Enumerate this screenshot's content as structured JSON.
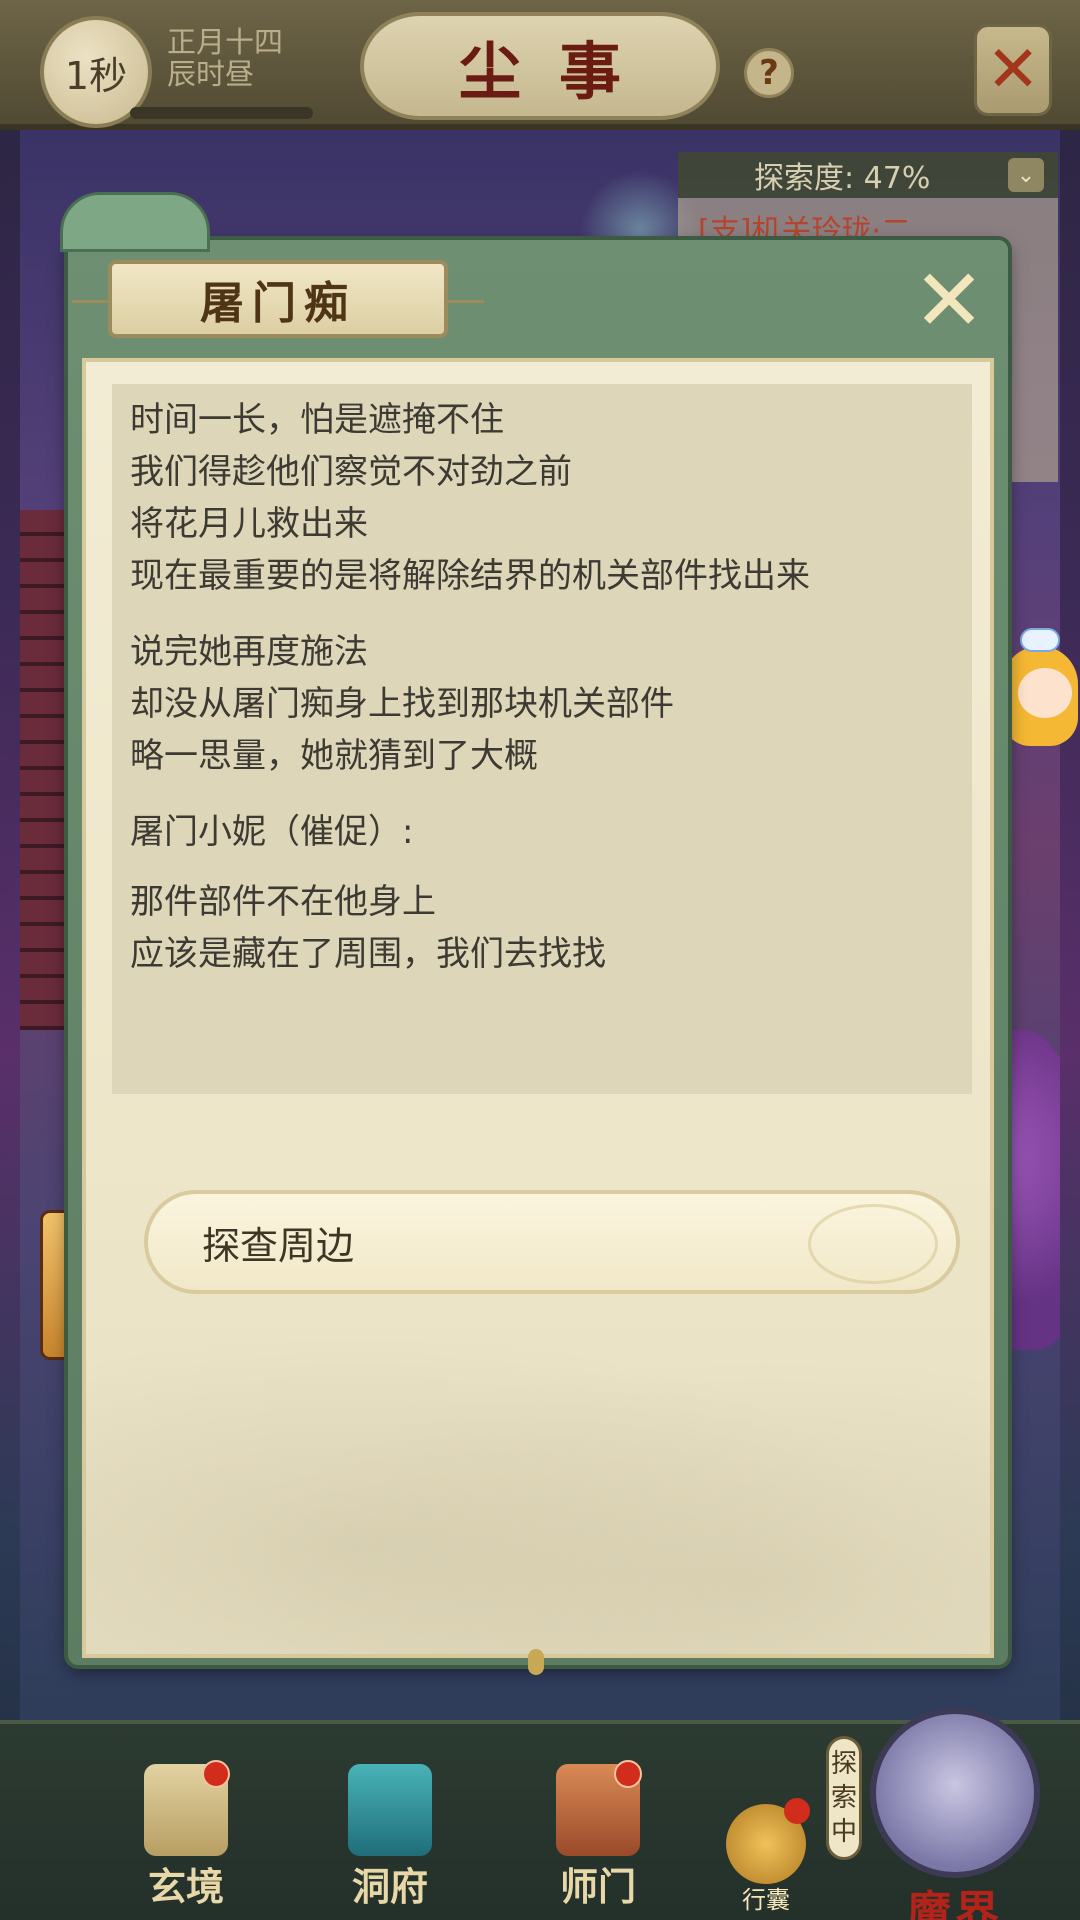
{
  "topbar": {
    "time": "1秒",
    "date_line1": "正月十四",
    "date_line2": "辰时昼",
    "title": "尘事",
    "help_label": "?",
    "exit_icon": "crossed-swords-icon"
  },
  "explore": {
    "progress_label": "探索度: 47%",
    "progress_fraction": 0.47,
    "quest": "[支]机关玲珑·二"
  },
  "dialog": {
    "speaker_name": "屠门痴",
    "paragraphs": [
      [
        "时间一长，怕是遮掩不住",
        "我们得趁他们察觉不对劲之前",
        "将花月儿救出来",
        "现在最重要的是将解除结界的机关部件找出来"
      ],
      [
        "说完她再度施法",
        "却没从屠门痴身上找到那块机关部件",
        "略一思量，她就猜到了大概"
      ]
    ],
    "speaker_line": "屠门小妮（催促）:",
    "quote": [
      "那件部件不在他身上",
      "应该是藏在了周围，我们去找找"
    ],
    "option_label": "探查周边"
  },
  "nav": {
    "xuanjing": "玄境",
    "dongfu": "洞府",
    "shimen": "师门",
    "xingnang": "行囊",
    "mojie": "魔界",
    "explore_tag": "探索中"
  },
  "colors": {
    "dialog_frame": "#6f8f73",
    "paper": "#f2ecd4",
    "text_box": "#ddd6b9",
    "accent_red": "#b4231a"
  }
}
